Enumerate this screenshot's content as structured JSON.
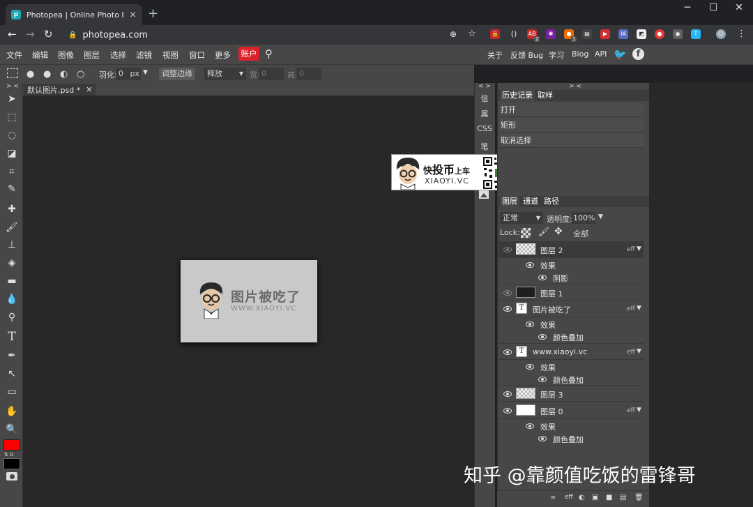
{
  "browser": {
    "tab_title": "Photopea | Online Photo Edito",
    "tab_close": "×",
    "new_tab": "+",
    "url": "photopea.com",
    "min": "─",
    "max": "☐",
    "close": "✕",
    "ext_badge_1": "2",
    "ext_badge_2": "1",
    "ext_ia": "IA",
    "ext_t": "T"
  },
  "menu": {
    "items": [
      "文件",
      "编辑",
      "图像",
      "图层",
      "选择",
      "滤镜",
      "视图",
      "窗口",
      "更多"
    ],
    "account": "账户",
    "right": [
      "关于",
      "反馈 Bug",
      "学习",
      "Blog",
      "API"
    ]
  },
  "options": {
    "feather_label": "羽化:",
    "feather_value": "0",
    "feather_unit": "px",
    "refine_edge": "调整边缘",
    "style_value": "释放",
    "width_label": "宽:",
    "width_value": "0",
    "height_label": "高:",
    "height_value": "0"
  },
  "document": {
    "tab_name": "默认图片.psd *",
    "tab_close": "✕",
    "image_title": "图片被吃了",
    "image_subtitle": "WWW.XIAOYI.VC"
  },
  "side_mini": [
    "信",
    "属",
    "CSS",
    "笔"
  ],
  "collapse_left": "> <",
  "collapse_mini": "< >",
  "collapse_right": "> <",
  "watermark": {
    "title_a": "快",
    "title_b": "投币",
    "title_c": "上车",
    "url": "XIAOYI.VC"
  },
  "history": {
    "tabs": [
      "历史记录",
      "取样"
    ],
    "items": [
      "打开",
      "矩形",
      "取消选择"
    ]
  },
  "layers": {
    "tabs": [
      "图层",
      "通道",
      "路径"
    ],
    "blend_mode": "正常",
    "opacity_label": "透明度:",
    "opacity_value": "100%",
    "lock_label": "Lock:",
    "lock_all": "全部",
    "effects_label": "效果",
    "eff_tag": "eff",
    "rows": [
      {
        "name": "图层 2",
        "effect": "阴影"
      },
      {
        "name": "图层 1"
      },
      {
        "name": "图片被吃了",
        "effect": "颜色叠加"
      },
      {
        "name": "www.xiaoyi.vc",
        "effect": "颜色叠加"
      },
      {
        "name": "图层 3"
      },
      {
        "name": "图层 0",
        "effect": "颜色叠加"
      }
    ]
  },
  "bottom_icons": [
    "∞",
    "eff",
    "◐",
    "▣",
    "■",
    "▤",
    "▢",
    "🗑"
  ],
  "footer_credit": "知乎 @靠颜值吃饭的雷锋哥",
  "colors": {
    "foreground": "#ff0000",
    "background": "#000000",
    "account_button": "#d8232a"
  }
}
